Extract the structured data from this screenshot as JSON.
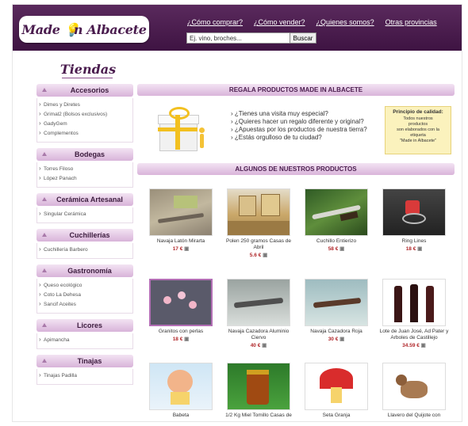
{
  "header": {
    "logo": "Made In Albacete",
    "nav": [
      "¿Cómo comprar?",
      "¿Cómo vender?",
      "¿Quienes somos?",
      "Otras provincias"
    ],
    "search": {
      "value": "Ej. vino, broches...",
      "button": "Buscar"
    }
  },
  "sidebar": {
    "title": "Tiendas",
    "categories": [
      {
        "name": "Accesorios",
        "items": [
          "Dimes y Diretes",
          "Grimal2 (Bolsos exclusivos)",
          "GadyGem",
          "Complementos"
        ]
      },
      {
        "name": "Bodegas",
        "items": [
          "Torres Filoso",
          "López Panach"
        ]
      },
      {
        "name": "Cerámica Artesanal",
        "items": [
          "Singular Cerámica"
        ]
      },
      {
        "name": "Cuchillerías",
        "items": [
          "Cuchillería Barbero"
        ]
      },
      {
        "name": "Gastronomía",
        "items": [
          "Queso ecológico",
          "Coto La Dehesa",
          "Sancif Aceites"
        ]
      },
      {
        "name": "Licores",
        "items": [
          "Apimancha"
        ]
      },
      {
        "name": "Tinajas",
        "items": [
          "Tinajas Padilla"
        ]
      }
    ]
  },
  "promo": {
    "title": "REGALA PRODUCTOS MADE IN ALBACETE",
    "questions": [
      "¿Tienes una visita muy especial?",
      "¿Quieres hacer un regalo diferente y original?",
      "¿Apuestas por los productos de nuestra tierra?",
      "¿Estás orgulloso de tu ciudad?"
    ],
    "quality_title": "Principio de calidad:",
    "quality_lines": [
      "Todos nuestros",
      "productos",
      "son elaborados con la",
      "etiqueta",
      "\"Made in Albacete\""
    ]
  },
  "products": {
    "title": "ALGUNOS DE NUESTROS PRODUCTOS",
    "items": [
      {
        "name": "Navaja Latón Mirarta",
        "price": "17 €"
      },
      {
        "name": "Polen 250 gramos Casas de Abril",
        "price": "5.6 €"
      },
      {
        "name": "Cuchillo Entierizo",
        "price": "58 €"
      },
      {
        "name": "Ring Lines",
        "price": "18 €"
      },
      {
        "name": "Granitos con perlas",
        "price": "18 €"
      },
      {
        "name": "Navaja Cazadora Aluminio Ciervo",
        "price": "40 €"
      },
      {
        "name": "Navaja Cazadora Roja",
        "price": "30 €"
      },
      {
        "name": "Lote de Juan José, Ad Pater y Arboles de Castillejo",
        "price": "34.59 €"
      },
      {
        "name": "Babeta",
        "price": ""
      },
      {
        "name": "1/2 Kg Miel Tomillo Casas de",
        "price": ""
      },
      {
        "name": "Seta Granja",
        "price": ""
      },
      {
        "name": "Llavero del Quijote con",
        "price": ""
      }
    ]
  },
  "colors": {
    "header_bg": "#4a1c4e",
    "section_bar": "#d9b4da",
    "price": "#b0272a",
    "quality_bg": "#fbf2bd"
  }
}
